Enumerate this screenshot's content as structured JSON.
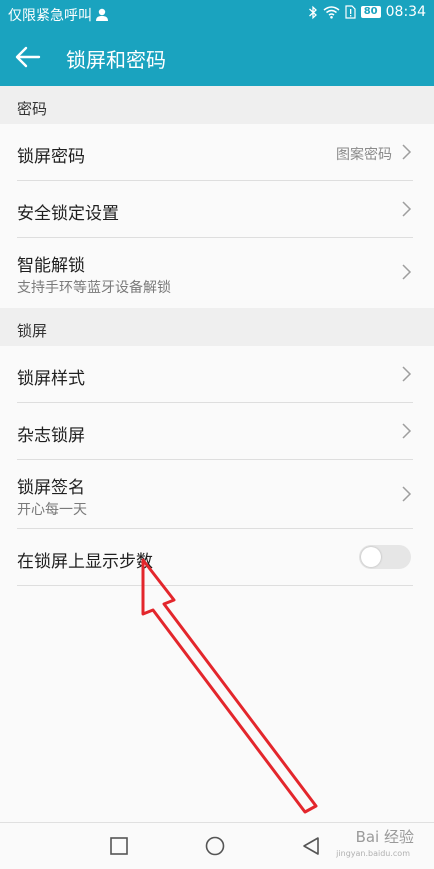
{
  "status_bar": {
    "carrier": "仅限紧急呼叫",
    "battery": "80",
    "time": "08:34"
  },
  "header": {
    "title": "锁屏和密码"
  },
  "sections": {
    "password": {
      "title": "密码",
      "items": {
        "lock_password": {
          "title": "锁屏密码",
          "value": "图案密码"
        },
        "secure_lock": {
          "title": "安全锁定设置"
        },
        "smart_unlock": {
          "title": "智能解锁",
          "subtitle": "支持手环等蓝牙设备解锁"
        }
      }
    },
    "lockscreen": {
      "title": "锁屏",
      "items": {
        "style": {
          "title": "锁屏样式"
        },
        "magazine": {
          "title": "杂志锁屏"
        },
        "signature": {
          "title": "锁屏签名",
          "subtitle": "开心每一天"
        },
        "show_steps": {
          "title": "在锁屏上显示步数",
          "enabled": false
        }
      }
    }
  },
  "watermark": {
    "text": "Bai 经验",
    "sub": "jingyan.baidu.com"
  },
  "colors": {
    "accent": "#1aa3bf",
    "annotation_arrow": "#e3262c"
  }
}
